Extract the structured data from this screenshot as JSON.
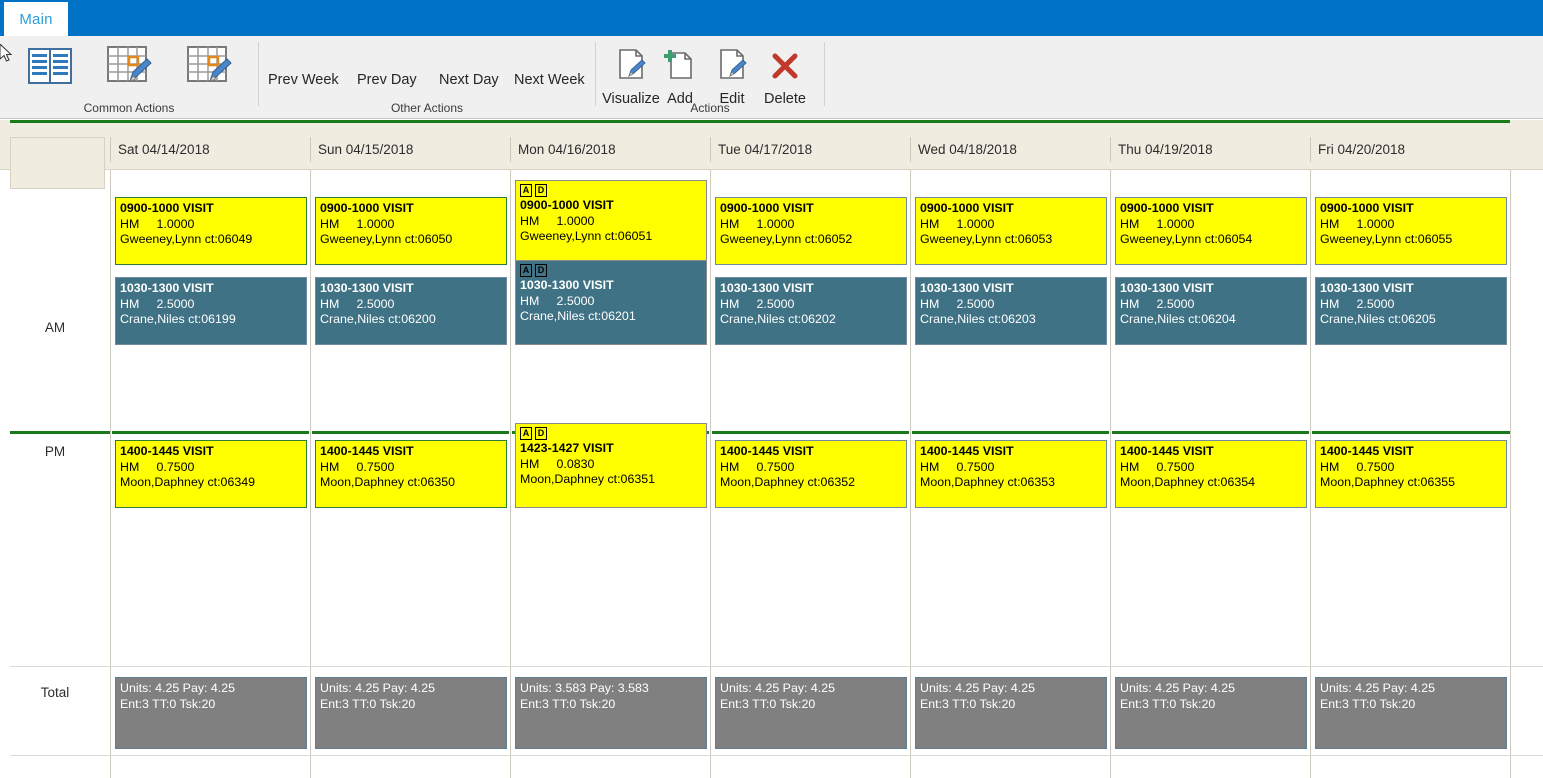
{
  "window": {
    "tab_label": "Main",
    "titlebar_color": "#0072c6"
  },
  "ribbon": {
    "groups": [
      {
        "label": "Common Actions"
      },
      {
        "label": "Other Actions"
      },
      {
        "label": "Actions"
      }
    ],
    "common_actions": [
      {
        "icon": "list-view-icon",
        "label": ""
      },
      {
        "icon": "calendar-edit-icon",
        "label": ""
      },
      {
        "icon": "calendar-edit-icon",
        "label": ""
      }
    ],
    "other_actions": [
      {
        "label": "Prev Week"
      },
      {
        "label": "Prev Day"
      },
      {
        "label": "Next Day"
      },
      {
        "label": "Next Week"
      }
    ],
    "actions": [
      {
        "label": "Visualize",
        "icon": "document-edit-icon"
      },
      {
        "label": "Add",
        "icon": "document-add-icon"
      },
      {
        "label": "Edit",
        "icon": "document-edit-icon"
      },
      {
        "label": "Delete",
        "icon": "red-x-icon"
      }
    ]
  },
  "calendar": {
    "row_labels": {
      "am": "AM",
      "pm": "PM",
      "total": "Total"
    },
    "columns": [
      {
        "header": "Sat 04/14/2018"
      },
      {
        "header": "Sun 04/15/2018"
      },
      {
        "header": "Mon 04/16/2018"
      },
      {
        "header": "Tue 04/17/2018"
      },
      {
        "header": "Wed 04/18/2018"
      },
      {
        "header": "Thu 04/19/2018"
      },
      {
        "header": "Fri 04/20/2018"
      }
    ],
    "am_appointments": [
      {
        "badges": [],
        "time": "0900-1000 VISIT",
        "code": "HM",
        "units": "1.0000",
        "client": "Gweeney,Lynn ct:06049",
        "style": "yellow greenb"
      },
      {
        "badges": [],
        "time": "0900-1000 VISIT",
        "code": "HM",
        "units": "1.0000",
        "client": "Gweeney,Lynn ct:06050",
        "style": "yellow greenb"
      },
      {
        "badges": [
          "A",
          "D"
        ],
        "time": "0900-1000 VISIT",
        "code": "HM",
        "units": "1.0000",
        "client": "Gweeney,Lynn ct:06051",
        "style": "yellow greyb"
      },
      {
        "badges": [],
        "time": "0900-1000 VISIT",
        "code": "HM",
        "units": "1.0000",
        "client": "Gweeney,Lynn ct:06052",
        "style": "yellow"
      },
      {
        "badges": [],
        "time": "0900-1000 VISIT",
        "code": "HM",
        "units": "1.0000",
        "client": "Gweeney,Lynn ct:06053",
        "style": "yellow"
      },
      {
        "badges": [],
        "time": "0900-1000 VISIT",
        "code": "HM",
        "units": "1.0000",
        "client": "Gweeney,Lynn ct:06054",
        "style": "yellow"
      },
      {
        "badges": [],
        "time": "0900-1000 VISIT",
        "code": "HM",
        "units": "1.0000",
        "client": "Gweeney,Lynn ct:06055",
        "style": "yellow"
      }
    ],
    "am_appointments_2": [
      {
        "badges": [],
        "time": "1030-1300 VISIT",
        "code": "HM",
        "units": "2.5000",
        "client": "Crane,Niles ct:06199",
        "style": "teal"
      },
      {
        "badges": [],
        "time": "1030-1300 VISIT",
        "code": "HM",
        "units": "2.5000",
        "client": "Crane,Niles ct:06200",
        "style": "teal"
      },
      {
        "badges": [
          "A",
          "D"
        ],
        "time": "1030-1300 VISIT",
        "code": "HM",
        "units": "2.5000",
        "client": "Crane,Niles ct:06201",
        "style": "teal greyb"
      },
      {
        "badges": [],
        "time": "1030-1300 VISIT",
        "code": "HM",
        "units": "2.5000",
        "client": "Crane,Niles ct:06202",
        "style": "teal"
      },
      {
        "badges": [],
        "time": "1030-1300 VISIT",
        "code": "HM",
        "units": "2.5000",
        "client": "Crane,Niles ct:06203",
        "style": "teal"
      },
      {
        "badges": [],
        "time": "1030-1300 VISIT",
        "code": "HM",
        "units": "2.5000",
        "client": "Crane,Niles ct:06204",
        "style": "teal"
      },
      {
        "badges": [],
        "time": "1030-1300 VISIT",
        "code": "HM",
        "units": "2.5000",
        "client": "Crane,Niles ct:06205",
        "style": "teal"
      }
    ],
    "pm_appointments": [
      {
        "badges": [],
        "time": "1400-1445 VISIT",
        "code": "HM",
        "units": "0.7500",
        "client": "Moon,Daphney ct:06349",
        "style": "yellow greenb"
      },
      {
        "badges": [],
        "time": "1400-1445 VISIT",
        "code": "HM",
        "units": "0.7500",
        "client": "Moon,Daphney ct:06350",
        "style": "yellow greenb"
      },
      {
        "badges": [
          "A",
          "D"
        ],
        "time": "1423-1427 VISIT",
        "code": "HM",
        "units": "0.0830",
        "client": "Moon,Daphney ct:06351",
        "style": "yellow greyb"
      },
      {
        "badges": [],
        "time": "1400-1445 VISIT",
        "code": "HM",
        "units": "0.7500",
        "client": "Moon,Daphney ct:06352",
        "style": "yellow"
      },
      {
        "badges": [],
        "time": "1400-1445 VISIT",
        "code": "HM",
        "units": "0.7500",
        "client": "Moon,Daphney ct:06353",
        "style": "yellow"
      },
      {
        "badges": [],
        "time": "1400-1445 VISIT",
        "code": "HM",
        "units": "0.7500",
        "client": "Moon,Daphney ct:06354",
        "style": "yellow"
      },
      {
        "badges": [],
        "time": "1400-1445 VISIT",
        "code": "HM",
        "units": "0.7500",
        "client": "Moon,Daphney ct:06355",
        "style": "yellow"
      }
    ],
    "totals": [
      {
        "line1": "Units: 4.25     Pay: 4.25",
        "line2": "Ent:3 TT:0 Tsk:20"
      },
      {
        "line1": "Units: 4.25     Pay: 4.25",
        "line2": "Ent:3 TT:0 Tsk:20"
      },
      {
        "line1": "Units: 3.583   Pay: 3.583",
        "line2": "Ent:3 TT:0 Tsk:20"
      },
      {
        "line1": "Units: 4.25     Pay: 4.25",
        "line2": "Ent:3 TT:0 Tsk:20"
      },
      {
        "line1": "Units: 4.25     Pay: 4.25",
        "line2": "Ent:3 TT:0 Tsk:20"
      },
      {
        "line1": "Units: 4.25     Pay: 4.25",
        "line2": "Ent:3 TT:0 Tsk:20"
      },
      {
        "line1": "Units: 4.25     Pay: 4.25",
        "line2": "Ent:3 TT:0 Tsk:20"
      }
    ]
  },
  "colors": {
    "title_blue": "#0072c6",
    "appt_yellow": "#ffff00",
    "appt_teal": "#3f7285",
    "total_grey": "#808080",
    "header_beige": "#f1ece0",
    "pm_divider_green": "#1a7a1a"
  }
}
